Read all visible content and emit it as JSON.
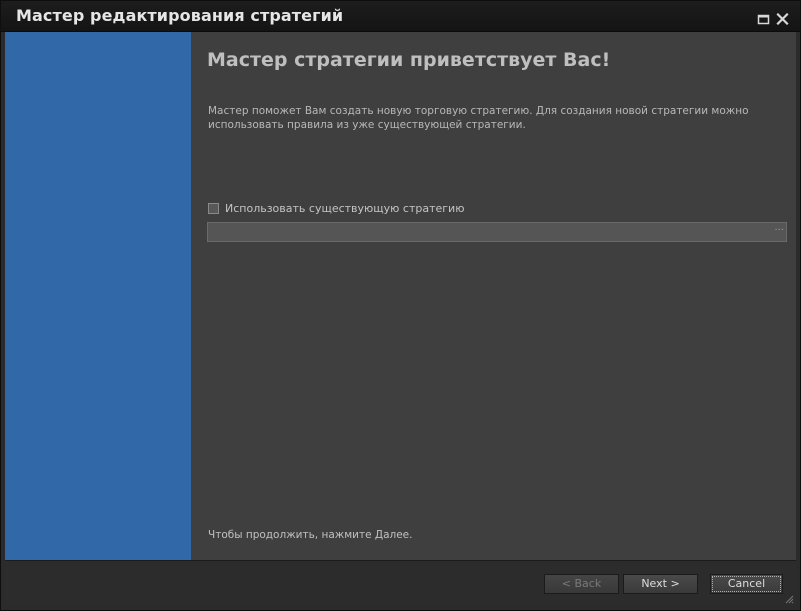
{
  "window": {
    "title": "Мастер редактирования стратегий",
    "controls": {
      "maximize_icon": "maximize-icon",
      "close_icon": "close-icon"
    }
  },
  "page": {
    "heading": "Мастер стратегии приветствует Вас!",
    "description": "Мастер поможет Вам создать новую торговую стратегию. Для создания новой стратегии можно использовать правила из уже существующей стратегии.",
    "use_existing_checkbox": {
      "label": "Использовать существующую стратегию",
      "checked": false
    },
    "strategy_path": {
      "value": "",
      "browse_label": "···"
    },
    "hint": "Чтобы продолжить, нажмите Далее."
  },
  "footer": {
    "back_label": "< Back",
    "next_label": "Next >",
    "cancel_label": "Cancel"
  },
  "colors": {
    "sidebar": "#3068a8",
    "content_bg": "#3f3f3f",
    "titlebar": "#171717"
  }
}
